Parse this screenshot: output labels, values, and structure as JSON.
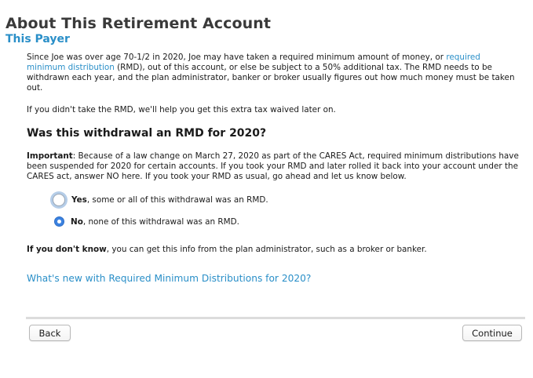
{
  "header": {
    "title": "About This Retirement Account",
    "subtitle": "This Payer"
  },
  "intro": {
    "text_before_link": "Since Joe was over age 70-1/2 in 2020, Joe may have taken a required minimum amount of money, or ",
    "link_text": "required minimum distribution",
    "text_after_link": " (RMD), out of this account, or else be subject to a 50% additional tax. The RMD needs to be withdrawn each year, and the plan administrator, banker or broker usually figures out how much money must be taken out."
  },
  "help_line": "If you didn't take the RMD, we'll help you get this extra tax waived later on.",
  "question": "Was this withdrawal an RMD for 2020?",
  "important": {
    "label": "Important",
    "text": ": Because of a law change on March 27, 2020 as part of the CARES Act, required minimum distributions have been suspended for 2020 for certain accounts. If you took your RMD and later rolled it back into your account under the CARES act, answer NO here. If you took your RMD as usual, go ahead and let us know below."
  },
  "options": [
    {
      "bold": "Yes",
      "rest": ", some or all of this withdrawal was an RMD.",
      "selected": false
    },
    {
      "bold": "No",
      "rest": ", none of this withdrawal was an RMD.",
      "selected": true
    }
  ],
  "dont_know": {
    "bold": "If you don't know",
    "rest": ", you can get this info from the plan administrator, such as a broker or banker."
  },
  "more_link": "What's new with Required Minimum Distributions for 2020?",
  "buttons": {
    "back": "Back",
    "continue": "Continue"
  },
  "colors": {
    "accent_blue": "#2a8fc8",
    "radio_selected": "#3b82e0",
    "title_gray": "#3a3a3a"
  }
}
